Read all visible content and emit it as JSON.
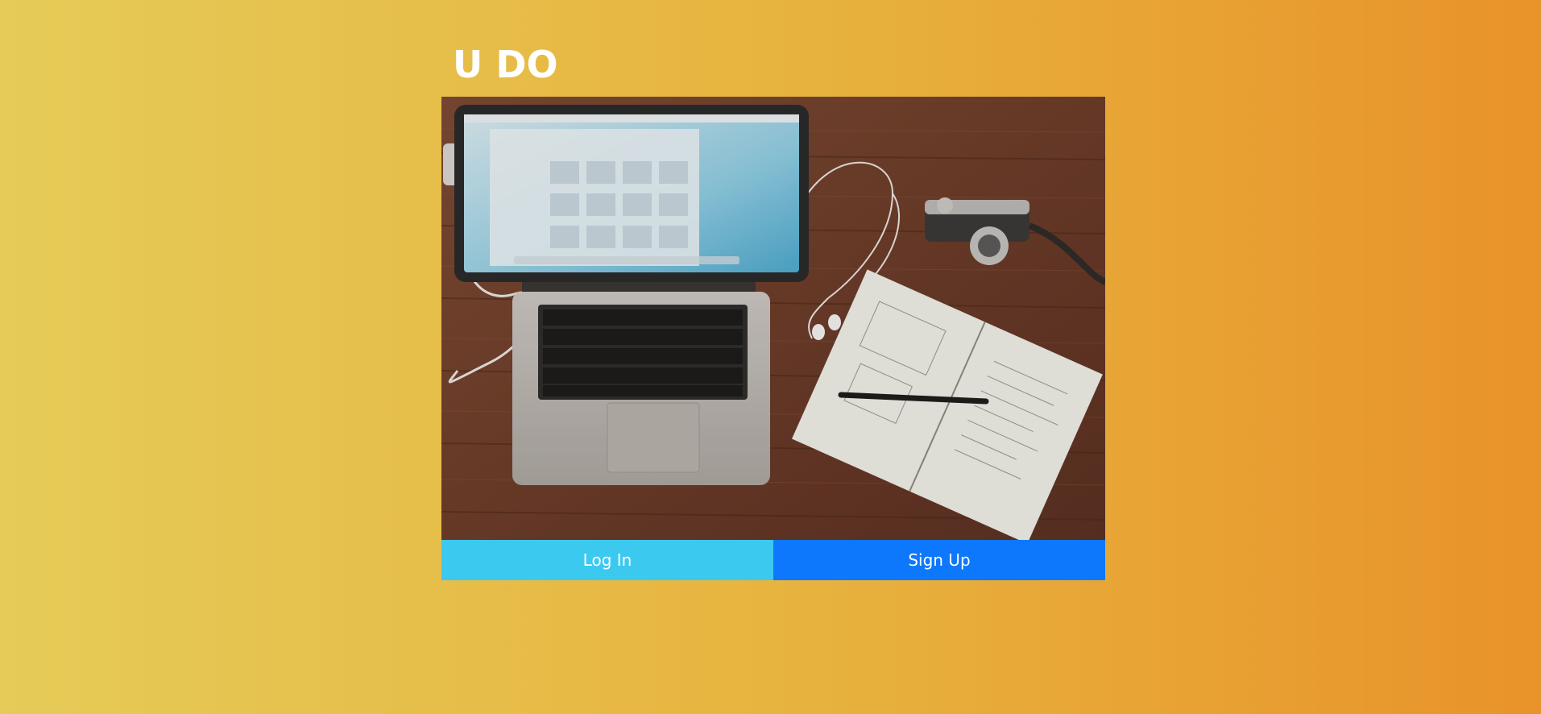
{
  "app": {
    "title": "U DO"
  },
  "hero": {
    "image_subject": "laptop, camera, earphones and notebook on wooden desk"
  },
  "actions": {
    "login_label": "Log In",
    "signup_label": "Sign Up"
  },
  "colors": {
    "gradient_start": "#e6cb58",
    "gradient_end": "#e8932a",
    "login_button": "#3cc9ef",
    "signup_button": "#0d78fc",
    "title_text": "#ffffff"
  }
}
